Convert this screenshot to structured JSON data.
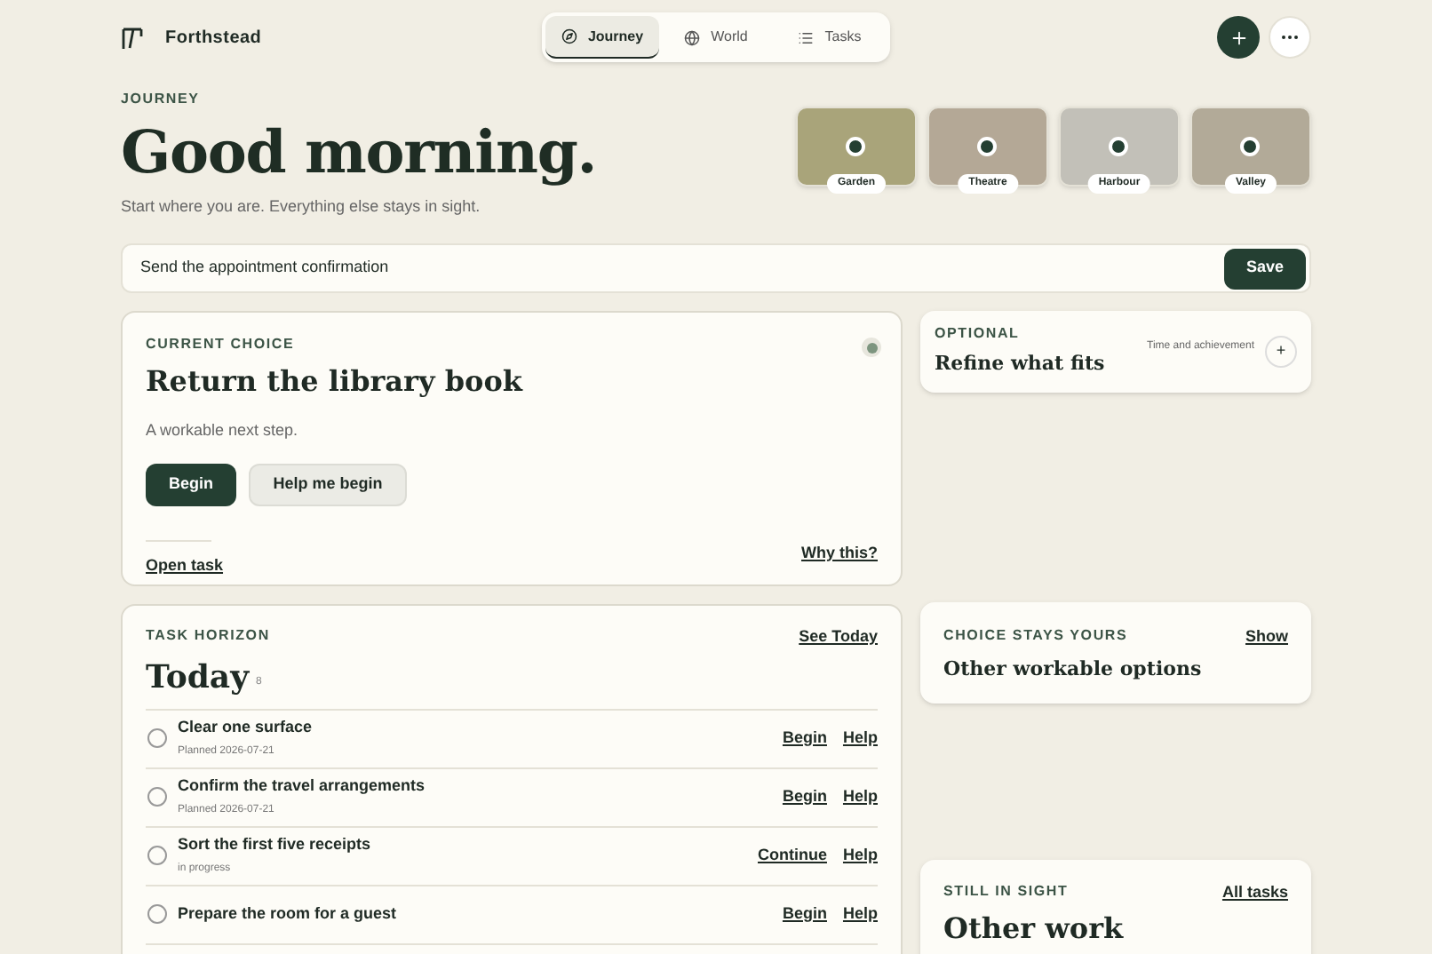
{
  "brand": {
    "name": "Forthstead"
  },
  "nav_tabs": [
    {
      "label": "Journey",
      "selected": true
    },
    {
      "label": "World",
      "selected": false
    },
    {
      "label": "Tasks",
      "selected": false
    }
  ],
  "header": {
    "eyebrow": "JOURNEY",
    "title": "Good morning.",
    "subtitle": "Start where you are. Everything else stays in sight."
  },
  "scenes": [
    {
      "label": "Garden"
    },
    {
      "label": "Theatre"
    },
    {
      "label": "Harbour"
    },
    {
      "label": "Valley"
    }
  ],
  "capture": {
    "value": "Send the appointment confirmation",
    "button": "Save"
  },
  "current_choice": {
    "eyebrow": "CURRENT CHOICE",
    "title": "Return the library book",
    "note": "A workable next step.",
    "primary": "Begin",
    "secondary": "Help me begin",
    "link": "Open task",
    "why": "Why this?"
  },
  "optional": {
    "eyebrow": "OPTIONAL",
    "title": "Refine what fits",
    "hint": "Time and achievement",
    "toggle": "+"
  },
  "task_horizon": {
    "eyebrow": "TASK HORIZON",
    "link": "See Today",
    "title": "Today",
    "count": "8",
    "tasks": [
      {
        "title": "Clear one surface",
        "meta": "Planned 2026-07-21",
        "action": "Begin",
        "help": "Help",
        "done": false
      },
      {
        "title": "Confirm the travel arrangements",
        "meta": "Planned 2026-07-21",
        "action": "Begin",
        "help": "Help",
        "done": false
      },
      {
        "title": "Sort the first five receipts",
        "meta": "in progress",
        "action": "Continue",
        "help": "Help",
        "done": false
      },
      {
        "title": "Prepare the room for a guest",
        "action": "Begin",
        "help": "Help",
        "done": false
      }
    ]
  },
  "choice_card": {
    "eyebrow": "CHOICE STAYS YOURS",
    "title": "Other workable options",
    "link": "Show"
  },
  "still_in_sight": {
    "eyebrow": "STILL IN SIGHT",
    "title": "Other work",
    "link": "All tasks"
  }
}
